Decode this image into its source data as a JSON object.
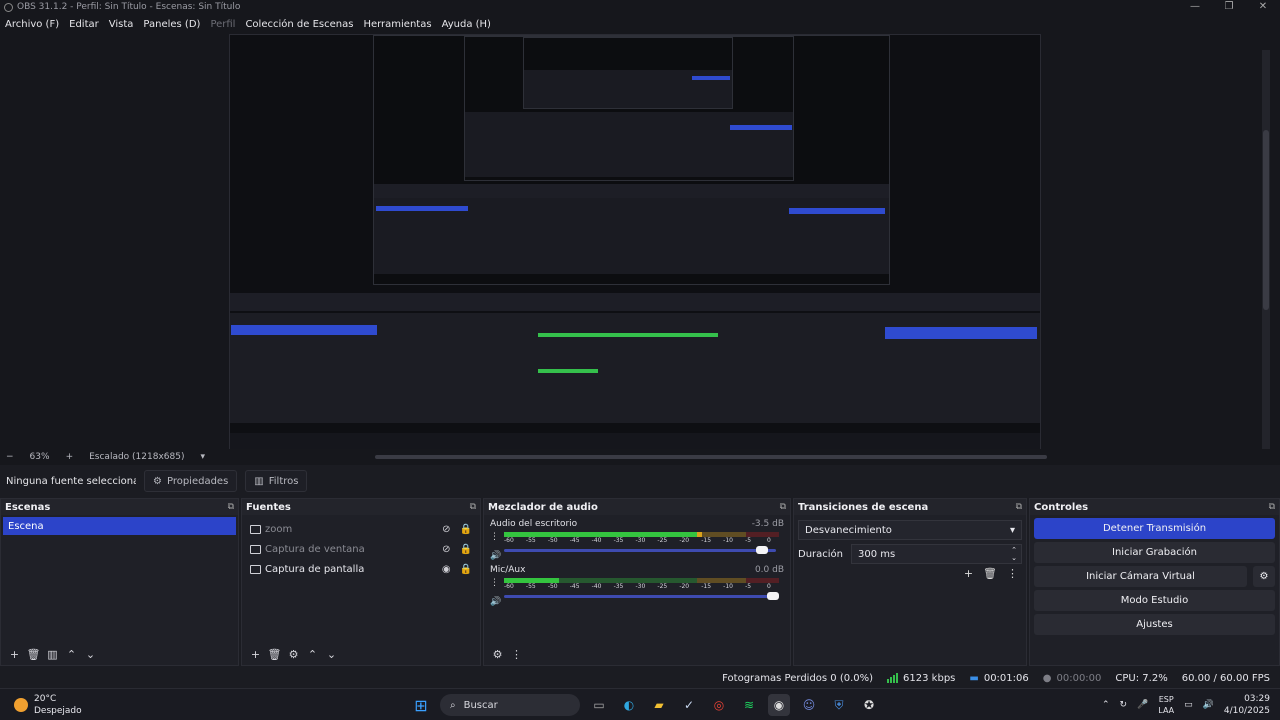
{
  "window": {
    "title": "OBS 31.1.2 - Perfil: Sin Título - Escenas: Sin Título",
    "controls": [
      "—",
      "❐",
      "✕"
    ]
  },
  "menu": [
    {
      "label": "Archivo (F)",
      "enabled": true
    },
    {
      "label": "Editar",
      "enabled": true
    },
    {
      "label": "Vista",
      "enabled": true
    },
    {
      "label": "Paneles (D)",
      "enabled": true
    },
    {
      "label": "Perfil",
      "enabled": false
    },
    {
      "label": "Colección de Escenas",
      "enabled": true
    },
    {
      "label": "Herramientas",
      "enabled": true
    },
    {
      "label": "Ayuda (H)",
      "enabled": true
    }
  ],
  "zoom": {
    "minus": "−",
    "percent": "63%",
    "plus": "+",
    "scale": "Escalado (1218x685)",
    "menu": "▾"
  },
  "props": {
    "no_source": "Ninguna fuente seleccionad",
    "properties": "Propiedades",
    "filters": "Filtros"
  },
  "scenes": {
    "title": "Escenas",
    "items": [
      "Escena"
    ]
  },
  "sources": {
    "title": "Fuentes",
    "items": [
      {
        "name": "zoom",
        "dim": true
      },
      {
        "name": "Captura de ventana",
        "dim": true
      },
      {
        "name": "Captura de pantalla",
        "dim": false
      }
    ]
  },
  "mixer": {
    "title": "Mezclador de audio",
    "channels": [
      {
        "name": "Audio del escritorio",
        "db": "-3.5 dB",
        "level": 0.72,
        "volume": 0.96
      },
      {
        "name": "Mic/Aux",
        "db": "0.0 dB",
        "level": 0.2,
        "volume": 1.0
      }
    ],
    "ticks": [
      "-60",
      "-55",
      "-50",
      "-45",
      "-40",
      "-35",
      "-30",
      "-25",
      "-20",
      "-15",
      "-10",
      "-5",
      "0"
    ]
  },
  "transitions": {
    "title": "Transiciones de escena",
    "selected": "Desvanecimiento",
    "duration_label": "Duración",
    "duration_value": "300 ms"
  },
  "controls": {
    "title": "Controles",
    "buttons": [
      "Detener Transmisión",
      "Iniciar Grabación",
      "Iniciar Cámara Virtual",
      "Modo Estudio",
      "Ajustes"
    ]
  },
  "status": {
    "dropped": "Fotogramas Perdidos 0 (0.0%)",
    "bitrate": "6123 kbps",
    "stream_time": "00:01:06",
    "rec_time": "00:00:00",
    "cpu": "CPU: 7.2%",
    "fps": "60.00 / 60.00 FPS"
  },
  "taskbar": {
    "temp": "20°C",
    "weather": "Despejado",
    "search": "Buscar",
    "lang1": "ESP",
    "lang2": "LAA",
    "time": "03:29",
    "date": "4/10/2025"
  },
  "colors": {
    "accent": "#2c44c9",
    "meter_green": "#34c43f",
    "meter_yellow": "#d9a21c",
    "meter_red": "#b42020"
  }
}
